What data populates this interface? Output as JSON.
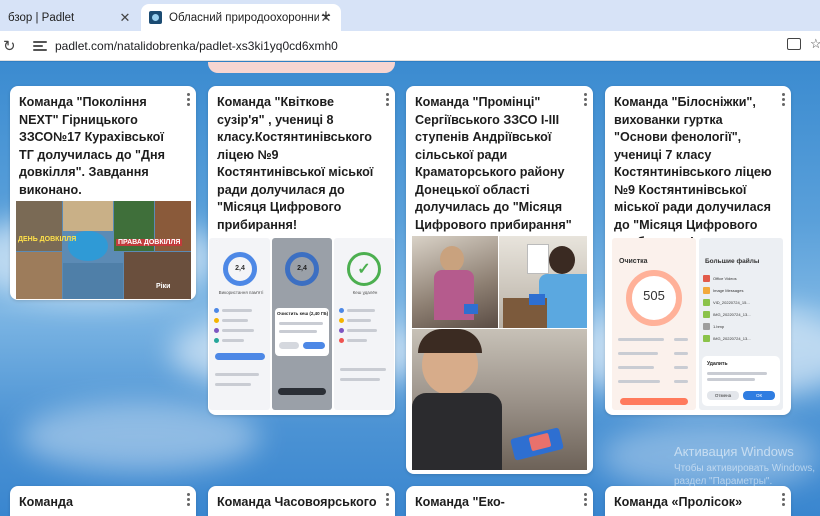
{
  "browser": {
    "tabs": [
      {
        "title": "бзор | Padlet",
        "active": false
      },
      {
        "title": "Обласний природоохоронни",
        "active": true
      }
    ],
    "new_tab": "+",
    "close_glyph": "✕",
    "url": "padlet.com/natalidobrenka/padlet-xs3ki1yq0cd6xmh0"
  },
  "cards": [
    {
      "text": "Команда \"Покоління NEXT\" Гірницького ЗЗСО№17 Курахівської ТГ долучилась до \"Дня довкілля\". Завдання виконано."
    },
    {
      "text": "Команда \"Квіткове сузір'я\" , учениці 8 класу.Костянтинівського ліцею №9 Костянтинівської міської ради долучилася до \"Місяця Цифрового прибирання!"
    },
    {
      "text": "Команда \"Промінці\" Сергіївського ЗЗСО І-ІІІ ступенів Андріївської сільської ради Краматорського району Донецької області долучилась до \"Місяця Цифрового прибирання\""
    },
    {
      "text": "Команда \"Білосніжки\", вихованки гуртка \"Основи фенології\", учениці 7 класу Костянтинівського ліцею №9 Костянтинівської міської ради долучилася до \"Місяця Цифрового прибирання!"
    },
    {
      "text": "Команда"
    },
    {
      "text": "Команда Часовоярського"
    },
    {
      "text": "Команда \"Еко-"
    },
    {
      "text": "Команда «Пролісок»"
    }
  ],
  "collage_labels": {
    "left": "ДЕНЬ ДОВКІЛЛЯ",
    "right": "ПРАВА ДОВКІЛЛЯ",
    "bottom": "Ріки"
  },
  "shots_card2": [
    {
      "value": "2,4",
      "caption": "Використання пам'яті"
    },
    {
      "value": "2,4",
      "caption": "Очистить кеш (2,40 ГБ)"
    },
    {
      "value": "✓",
      "caption": "Кеш удалён"
    }
  ],
  "shots_card4": {
    "left_title": "Очистка",
    "left_value": "505",
    "right_title": "Большие файлы",
    "right_items": [
      "Office Videos",
      "Image Messages",
      "VID_20220724_15...",
      "IMG_20220724_13...",
      "1.bmp",
      "IMG_20220724_13..."
    ],
    "dialog_title": "Удалить",
    "dialog_buttons": [
      "Отмена",
      "ОК"
    ]
  },
  "watermark": {
    "line1": "Активация Windows",
    "line2": "Чтобы активировать Windows,",
    "line3": "раздел \"Параметры\"."
  },
  "colors": {
    "accent_blue": "#3b8bd0",
    "card_bg": "#ffffff",
    "tabbar": "#d7e3f7",
    "green_check": "#4caf50",
    "orange_ring": "#ff8a65"
  }
}
